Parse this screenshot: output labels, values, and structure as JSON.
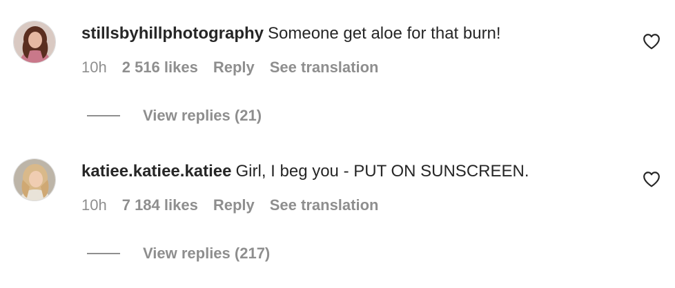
{
  "comments": [
    {
      "username": "stillsbyhillphotography",
      "text": "Someone get aloe for that burn!",
      "time": "10h",
      "likes": "2 516 likes",
      "reply_label": "Reply",
      "translate_label": "See translation",
      "view_replies": "View replies (21)",
      "avatar_icon": "avatar-photo-icon",
      "like_icon": "heart-outline-icon"
    },
    {
      "username": "katiee.katiee.katiee",
      "text": "Girl, I beg you - PUT ON SUNSCREEN.",
      "time": "10h",
      "likes": "7 184 likes",
      "reply_label": "Reply",
      "translate_label": "See translation",
      "view_replies": "View replies (217)",
      "avatar_icon": "avatar-photo-icon",
      "like_icon": "heart-outline-icon"
    }
  ],
  "colors": {
    "text": "#262626",
    "secondary": "#8e8e8e",
    "background": "#ffffff"
  }
}
